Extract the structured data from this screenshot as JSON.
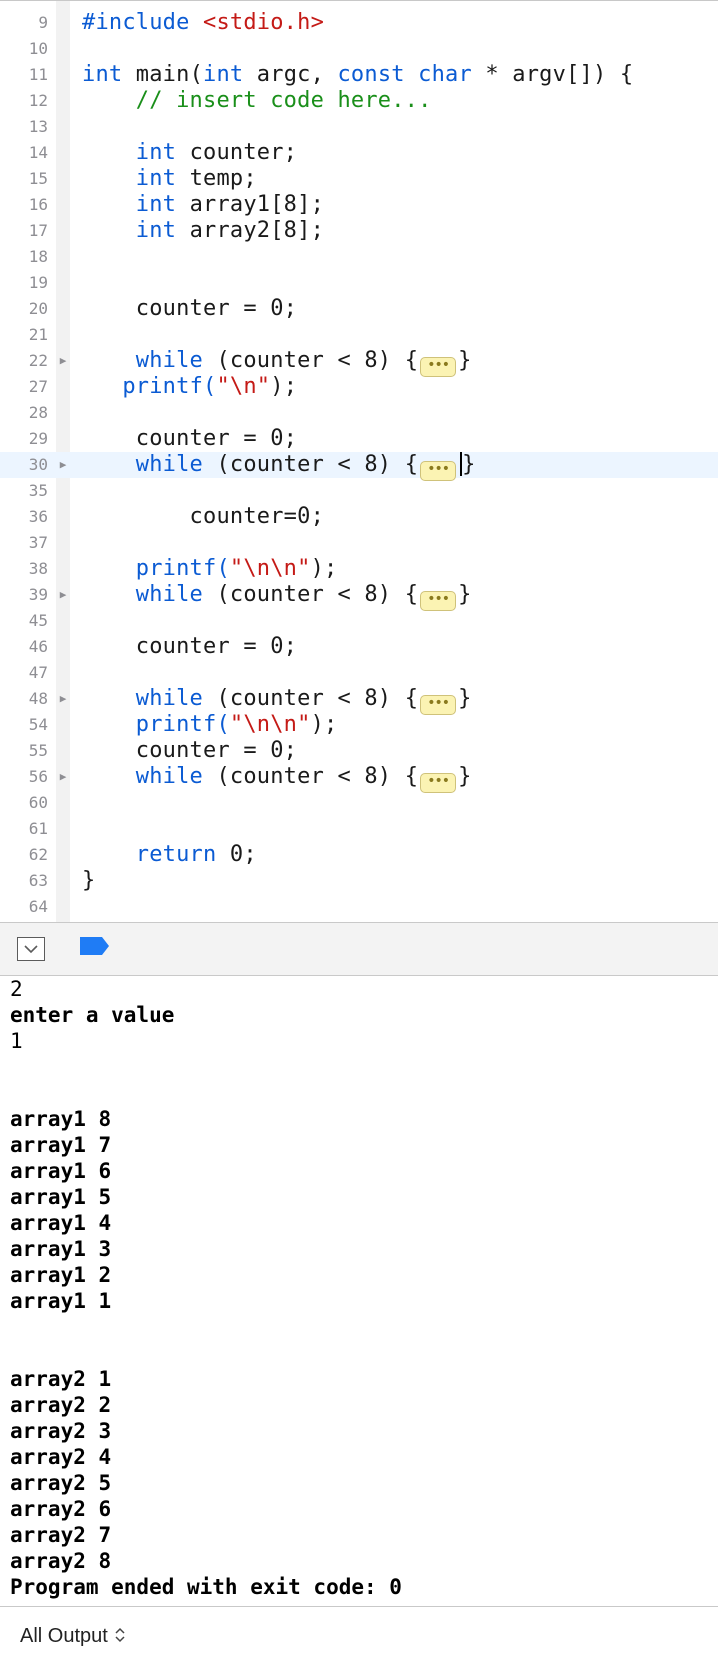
{
  "editor": {
    "lines": [
      {
        "no": "9",
        "fold": false,
        "tokens": [
          {
            "t": "#include ",
            "c": "inc"
          },
          {
            "t": "<stdio.h>",
            "c": "str"
          }
        ]
      },
      {
        "no": "10",
        "fold": false,
        "tokens": []
      },
      {
        "no": "11",
        "fold": false,
        "tokens": [
          {
            "t": "int",
            "c": "kw"
          },
          {
            "t": " main("
          },
          {
            "t": "int",
            "c": "kw"
          },
          {
            "t": " argc, "
          },
          {
            "t": "const",
            "c": "kw"
          },
          {
            "t": " "
          },
          {
            "t": "char",
            "c": "kw"
          },
          {
            "t": " * argv[]) {"
          }
        ]
      },
      {
        "no": "12",
        "fold": false,
        "tokens": [
          {
            "t": "    "
          },
          {
            "t": "// insert code here...",
            "c": "cmt"
          }
        ]
      },
      {
        "no": "13",
        "fold": false,
        "tokens": []
      },
      {
        "no": "14",
        "fold": false,
        "tokens": [
          {
            "t": "    "
          },
          {
            "t": "int",
            "c": "kw"
          },
          {
            "t": " counter;"
          }
        ]
      },
      {
        "no": "15",
        "fold": false,
        "tokens": [
          {
            "t": "    "
          },
          {
            "t": "int",
            "c": "kw"
          },
          {
            "t": " temp;"
          }
        ]
      },
      {
        "no": "16",
        "fold": false,
        "tokens": [
          {
            "t": "    "
          },
          {
            "t": "int",
            "c": "kw"
          },
          {
            "t": " array1[8];"
          }
        ]
      },
      {
        "no": "17",
        "fold": false,
        "tokens": [
          {
            "t": "    "
          },
          {
            "t": "int",
            "c": "kw"
          },
          {
            "t": " array2[8];"
          }
        ]
      },
      {
        "no": "18",
        "fold": false,
        "tokens": []
      },
      {
        "no": "19",
        "fold": false,
        "tokens": []
      },
      {
        "no": "20",
        "fold": false,
        "tokens": [
          {
            "t": "    counter = 0;"
          }
        ]
      },
      {
        "no": "21",
        "fold": false,
        "tokens": []
      },
      {
        "no": "22",
        "fold": true,
        "tokens": [
          {
            "t": "    "
          },
          {
            "t": "while",
            "c": "kw"
          },
          {
            "t": " (counter < 8) {"
          },
          {
            "pill": true
          },
          {
            "t": "}"
          }
        ]
      },
      {
        "no": "27",
        "fold": false,
        "tokens": [
          {
            "t": "   "
          },
          {
            "t": "printf(",
            "c": "kw"
          },
          {
            "t": "\"\\n\"",
            "c": "str"
          },
          {
            "t": ");"
          }
        ]
      },
      {
        "no": "28",
        "fold": false,
        "tokens": []
      },
      {
        "no": "29",
        "fold": false,
        "tokens": [
          {
            "t": "    counter = 0;"
          }
        ]
      },
      {
        "no": "30",
        "fold": true,
        "current": true,
        "tokens": [
          {
            "t": "    "
          },
          {
            "t": "while",
            "c": "kw"
          },
          {
            "t": " (counter < 8) {"
          },
          {
            "pill": true
          },
          {
            "caret": true
          },
          {
            "t": "}"
          }
        ]
      },
      {
        "no": "35",
        "fold": false,
        "tokens": []
      },
      {
        "no": "36",
        "fold": false,
        "tokens": [
          {
            "t": "        counter=0;"
          }
        ]
      },
      {
        "no": "37",
        "fold": false,
        "tokens": []
      },
      {
        "no": "38",
        "fold": false,
        "tokens": [
          {
            "t": "    "
          },
          {
            "t": "printf(",
            "c": "kw"
          },
          {
            "t": "\"\\n\\n\"",
            "c": "str"
          },
          {
            "t": ");"
          }
        ]
      },
      {
        "no": "39",
        "fold": true,
        "tokens": [
          {
            "t": "    "
          },
          {
            "t": "while",
            "c": "kw"
          },
          {
            "t": " (counter < 8) {"
          },
          {
            "pill": true
          },
          {
            "t": "}"
          }
        ]
      },
      {
        "no": "45",
        "fold": false,
        "tokens": []
      },
      {
        "no": "46",
        "fold": false,
        "tokens": [
          {
            "t": "    counter = 0;"
          }
        ]
      },
      {
        "no": "47",
        "fold": false,
        "tokens": []
      },
      {
        "no": "48",
        "fold": true,
        "tokens": [
          {
            "t": "    "
          },
          {
            "t": "while",
            "c": "kw"
          },
          {
            "t": " (counter < 8) {"
          },
          {
            "pill": true
          },
          {
            "t": "}"
          }
        ]
      },
      {
        "no": "54",
        "fold": false,
        "tokens": [
          {
            "t": "    "
          },
          {
            "t": "printf(",
            "c": "kw"
          },
          {
            "t": "\"\\n\\n\"",
            "c": "str"
          },
          {
            "t": ");"
          }
        ]
      },
      {
        "no": "55",
        "fold": false,
        "tokens": [
          {
            "t": "    counter = 0;"
          }
        ]
      },
      {
        "no": "56",
        "fold": true,
        "tokens": [
          {
            "t": "    "
          },
          {
            "t": "while",
            "c": "kw"
          },
          {
            "t": " (counter < 8) {"
          },
          {
            "pill": true
          },
          {
            "t": "}"
          }
        ]
      },
      {
        "no": "60",
        "fold": false,
        "tokens": []
      },
      {
        "no": "61",
        "fold": false,
        "tokens": []
      },
      {
        "no": "62",
        "fold": false,
        "tokens": [
          {
            "t": "    "
          },
          {
            "t": "return",
            "c": "kw"
          },
          {
            "t": " 0;"
          }
        ]
      },
      {
        "no": "63",
        "fold": false,
        "tokens": [
          {
            "t": "}"
          }
        ]
      },
      {
        "no": "64",
        "fold": false,
        "tokens": []
      }
    ],
    "fold_arrow_glyph": "▶",
    "fold_pill_text": "•••",
    "colors": {
      "keyword": "#0b5bd3",
      "string": "#c41a16",
      "comment": "#1a8f1a",
      "current_line": "#ecf5ff"
    }
  },
  "debug_bar": {
    "hide_icon": "hide-debug-area-icon",
    "breakpoint_icon": "breakpoint-icon",
    "breakpoint_color": "#1f7cf5"
  },
  "console": {
    "lines": [
      {
        "text": "2",
        "echo": true
      },
      {
        "text": "enter a value",
        "echo": false
      },
      {
        "text": "1",
        "echo": true
      },
      {
        "text": "",
        "echo": false
      },
      {
        "text": "",
        "echo": false
      },
      {
        "text": "array1 8",
        "echo": false
      },
      {
        "text": "array1 7",
        "echo": false
      },
      {
        "text": "array1 6",
        "echo": false
      },
      {
        "text": "array1 5",
        "echo": false
      },
      {
        "text": "array1 4",
        "echo": false
      },
      {
        "text": "array1 3",
        "echo": false
      },
      {
        "text": "array1 2",
        "echo": false
      },
      {
        "text": "array1 1",
        "echo": false
      },
      {
        "text": "",
        "echo": false
      },
      {
        "text": "",
        "echo": false
      },
      {
        "text": "array2 1",
        "echo": false
      },
      {
        "text": "array2 2",
        "echo": false
      },
      {
        "text": "array2 3",
        "echo": false
      },
      {
        "text": "array2 4",
        "echo": false
      },
      {
        "text": "array2 5",
        "echo": false
      },
      {
        "text": "array2 6",
        "echo": false
      },
      {
        "text": "array2 7",
        "echo": false
      },
      {
        "text": "array2 8",
        "echo": false
      },
      {
        "text": "Program ended with exit code: 0",
        "echo": false
      }
    ]
  },
  "bottom_bar": {
    "filter_label": "All Output",
    "filter_icon": "up-down-chevron-icon"
  }
}
